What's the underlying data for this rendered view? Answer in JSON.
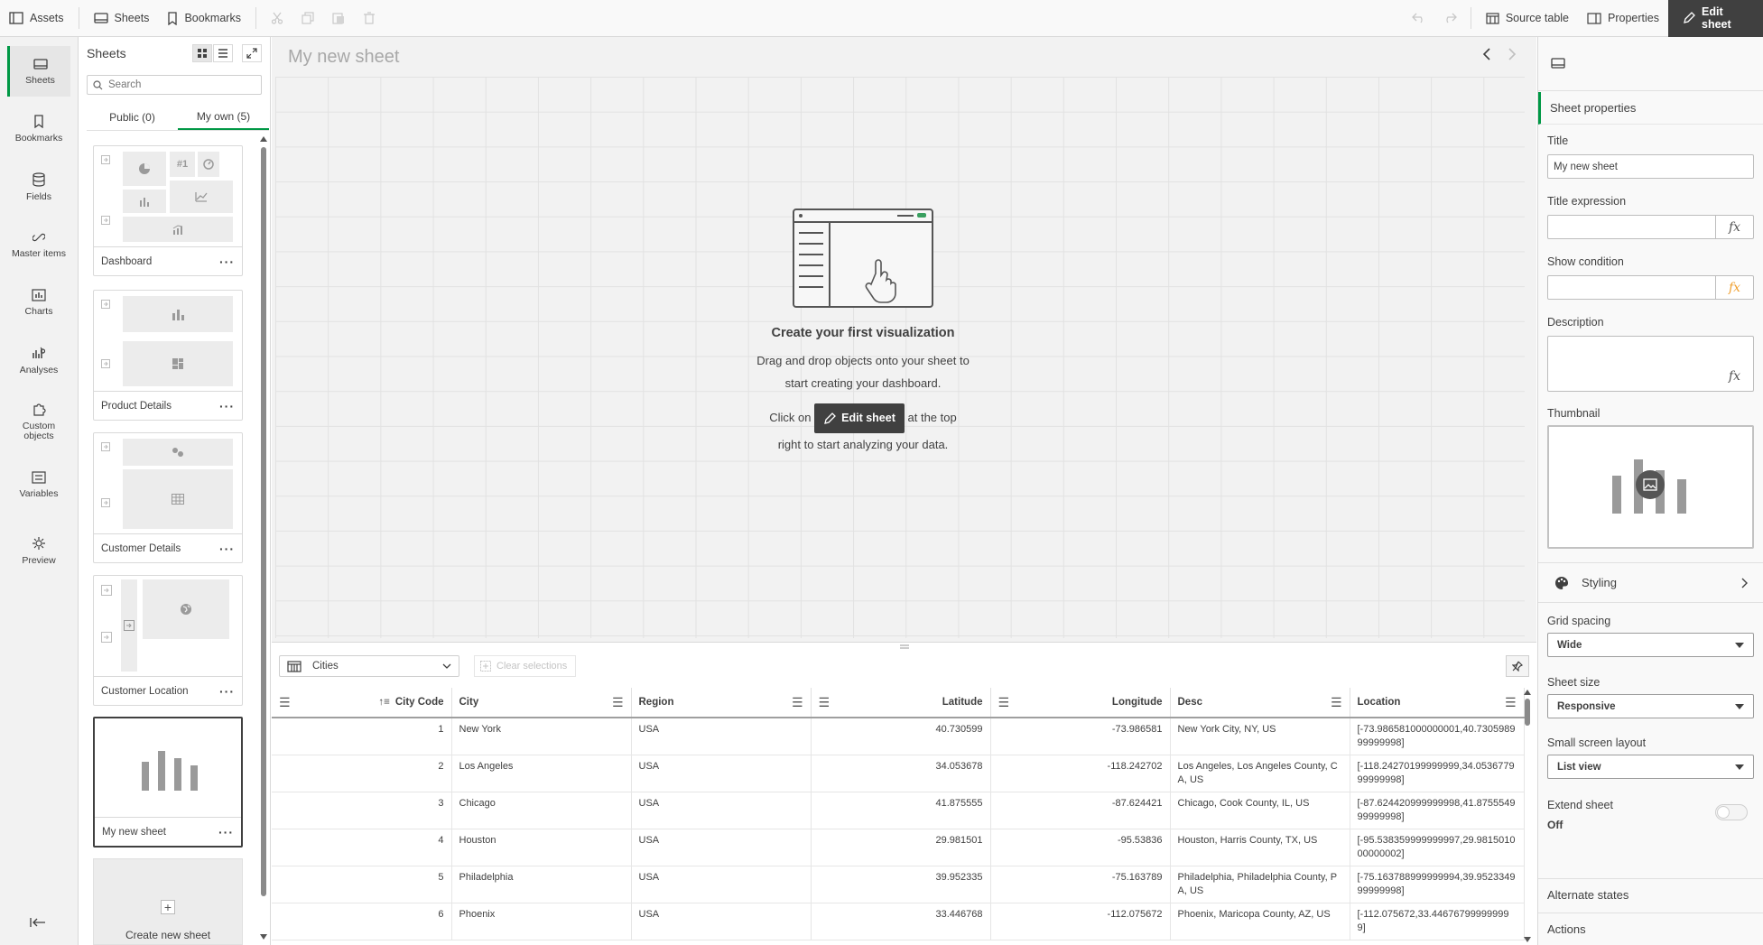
{
  "toolbar": {
    "assets": "Assets",
    "sheets": "Sheets",
    "bookmarks": "Bookmarks",
    "source_table": "Source table",
    "properties": "Properties",
    "edit_sheet": "Edit sheet"
  },
  "rail": {
    "items": [
      {
        "label": "Sheets",
        "icon": "sheets-icon"
      },
      {
        "label": "Bookmarks",
        "icon": "bookmark-icon"
      },
      {
        "label": "Fields",
        "icon": "database-icon"
      },
      {
        "label": "Master items",
        "icon": "link-icon"
      },
      {
        "label": "Charts",
        "icon": "chart-icon"
      },
      {
        "label": "Analyses",
        "icon": "analyses-icon"
      },
      {
        "label": "Custom objects",
        "icon": "puzzle-icon"
      },
      {
        "label": "Variables",
        "icon": "variables-icon"
      },
      {
        "label": "Preview",
        "icon": "preview-icon"
      }
    ]
  },
  "sheets_panel": {
    "title": "Sheets",
    "search_placeholder": "Search",
    "tabs": [
      "Public (0)",
      "My own (5)"
    ],
    "sheets": [
      {
        "title": "Dashboard"
      },
      {
        "title": "Product Details"
      },
      {
        "title": "Customer Details"
      },
      {
        "title": "Customer Location"
      },
      {
        "title": "My new sheet"
      }
    ],
    "create_label": "Create new sheet"
  },
  "canvas": {
    "sheet_title": "My new sheet",
    "empty_title": "Create your first visualization",
    "empty_line1": "Drag and drop objects onto your sheet to",
    "empty_line2": "start creating your dashboard.",
    "click_on": "Click on",
    "edit_sheet": "Edit sheet",
    "at_the_top": "at the top",
    "empty_line4": "right to start analyzing your data."
  },
  "table": {
    "selected_table": "Cities",
    "clear_selections": "Clear selections",
    "columns": [
      "City Code",
      "City",
      "Region",
      "Latitude",
      "Longitude",
      "Desc",
      "Location"
    ],
    "rows": [
      [
        "1",
        "New York",
        "USA",
        "40.730599",
        "-73.986581",
        "New York City, NY, US",
        "[-73.986581000000001,40.730598999999998]"
      ],
      [
        "2",
        "Los Angeles",
        "USA",
        "34.053678",
        "-118.242702",
        "Los Angeles, Los Angeles County, CA, US",
        "[-118.24270199999999,34.053677999999998]"
      ],
      [
        "3",
        "Chicago",
        "USA",
        "41.875555",
        "-87.624421",
        "Chicago, Cook County, IL, US",
        "[-87.624420999999998,41.875554999999998]"
      ],
      [
        "4",
        "Houston",
        "USA",
        "29.981501",
        "-95.53836",
        "Houston, Harris County, TX, US",
        "[-95.538359999999997,29.981501000000002]"
      ],
      [
        "5",
        "Philadelphia",
        "USA",
        "39.952335",
        "-75.163789",
        "Philadelphia, Philadelphia County, PA, US",
        "[-75.163788999999994,39.952334999999998]"
      ],
      [
        "6",
        "Phoenix",
        "USA",
        "33.446768",
        "-112.075672",
        "Phoenix, Maricopa County, AZ, US",
        "[-112.075672,33.446767999999999]"
      ]
    ]
  },
  "properties": {
    "section_title": "Sheet properties",
    "title_label": "Title",
    "title_value": "My new sheet",
    "title_expression_label": "Title expression",
    "show_condition_label": "Show condition",
    "description_label": "Description",
    "thumbnail_label": "Thumbnail",
    "styling_label": "Styling",
    "grid_spacing_label": "Grid spacing",
    "grid_spacing_value": "Wide",
    "sheet_size_label": "Sheet size",
    "sheet_size_value": "Responsive",
    "small_screen_label": "Small screen layout",
    "small_screen_value": "List view",
    "extend_sheet_label": "Extend sheet",
    "extend_sheet_value": "Off",
    "alternate_states_label": "Alternate states",
    "actions_label": "Actions",
    "fx": "fx"
  },
  "colors": {
    "accent_green": "#009845",
    "dark": "#404040",
    "fx_orange": "#f0a030"
  }
}
